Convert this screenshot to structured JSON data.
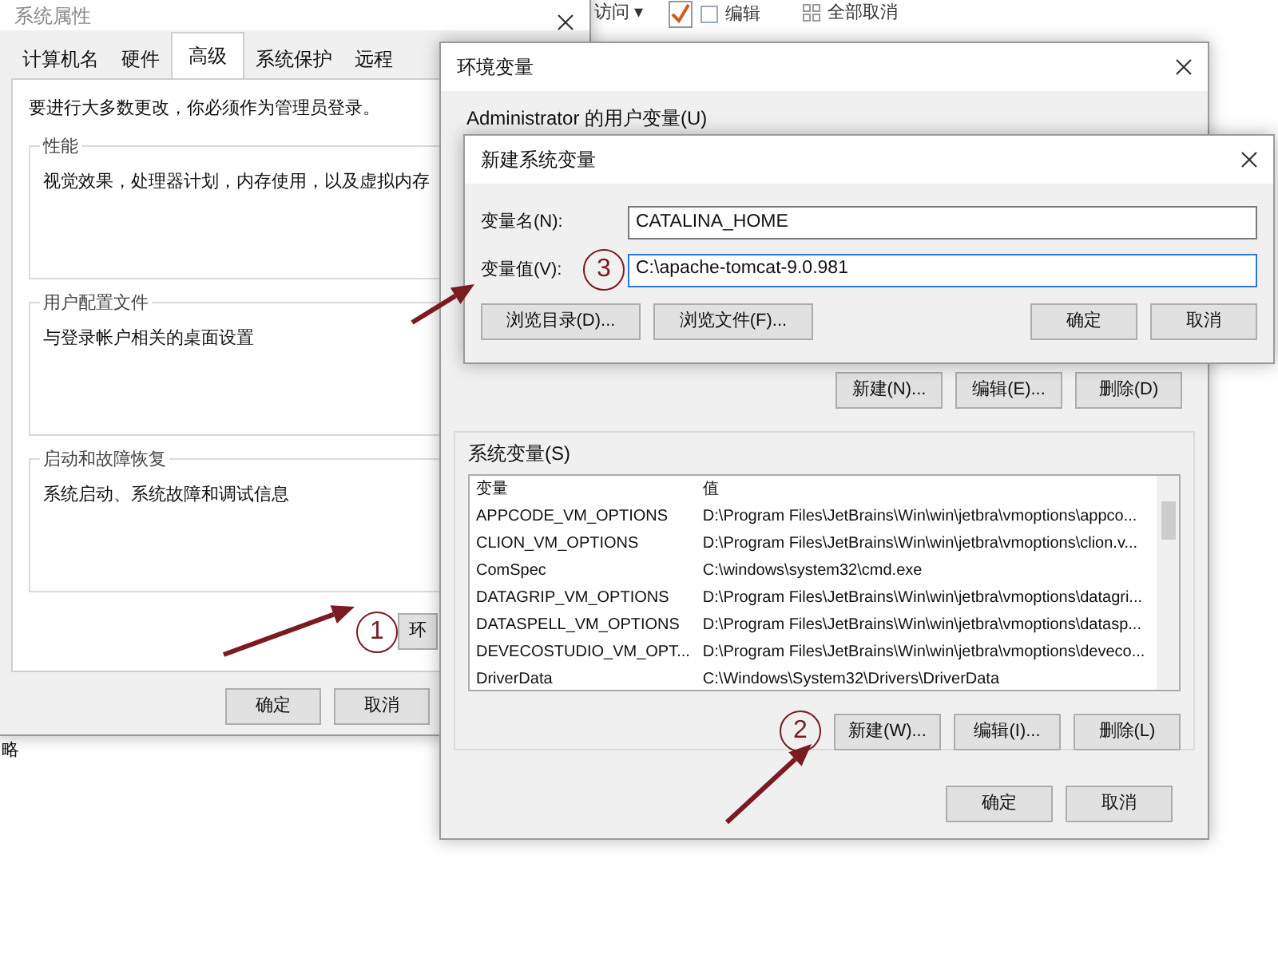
{
  "explorer_ribbon": {
    "items": [
      {
        "kind": "dropdown",
        "label": "访问 ▾"
      },
      {
        "kind": "check",
        "label": "编辑"
      },
      {
        "kind": "grid",
        "label": "全部取消"
      }
    ]
  },
  "side_text": "略",
  "system_properties": {
    "title": "系统属性",
    "tabs": [
      {
        "label": "计算机名",
        "selected": false
      },
      {
        "label": "硬件",
        "selected": false
      },
      {
        "label": "高级",
        "selected": true
      },
      {
        "label": "系统保护",
        "selected": false
      },
      {
        "label": "远程",
        "selected": false
      }
    ],
    "notice": "要进行大多数更改，你必须作为管理员登录。",
    "groups": [
      {
        "title": "性能",
        "text": "视觉效果，处理器计划，内存使用，以及虚拟内存"
      },
      {
        "title": "用户配置文件",
        "text": "与登录帐户相关的桌面设置"
      },
      {
        "title": "启动和故障恢复",
        "text": "系统启动、系统故障和调试信息"
      }
    ],
    "env_button": {
      "label": "环",
      "step": "1"
    },
    "buttons": [
      "确定",
      "取消"
    ]
  },
  "environment_variables": {
    "title": "环境变量",
    "user_vars_label": "Administrator 的用户变量(U)",
    "user_buttons": [
      {
        "label": "新建(N)..."
      },
      {
        "label": "编辑(E)..."
      },
      {
        "label": "删除(D)"
      }
    ],
    "system_vars_label": "系统变量(S)",
    "table": {
      "columns": [
        "变量",
        "值"
      ],
      "rows": [
        [
          "APPCODE_VM_OPTIONS",
          "D:\\Program Files\\JetBrains\\Win\\win\\jetbra\\vmoptions\\appco..."
        ],
        [
          "CLION_VM_OPTIONS",
          "D:\\Program Files\\JetBrains\\Win\\win\\jetbra\\vmoptions\\clion.v..."
        ],
        [
          "ComSpec",
          "C:\\windows\\system32\\cmd.exe"
        ],
        [
          "DATAGRIP_VM_OPTIONS",
          "D:\\Program Files\\JetBrains\\Win\\win\\jetbra\\vmoptions\\datagri..."
        ],
        [
          "DATASPELL_VM_OPTIONS",
          "D:\\Program Files\\JetBrains\\Win\\win\\jetbra\\vmoptions\\datasp..."
        ],
        [
          "DEVECOSTUDIO_VM_OPT...",
          "D:\\Program Files\\JetBrains\\Win\\win\\jetbra\\vmoptions\\deveco..."
        ],
        [
          "DriverData",
          "C:\\Windows\\System32\\Drivers\\DriverData"
        ]
      ]
    },
    "system_buttons": [
      {
        "label": "新建(W)...",
        "step": "2"
      },
      {
        "label": "编辑(I)..."
      },
      {
        "label": "删除(L)"
      }
    ],
    "buttons": [
      "确定",
      "取消"
    ]
  },
  "new_system_variable": {
    "title": "新建系统变量",
    "fields": [
      {
        "label": "变量名(N):",
        "value": "CATALINA_HOME",
        "focused": false
      },
      {
        "label": "变量值(V):",
        "value": "C:\\apache-tomcat-9.0.981",
        "focused": true,
        "step": "3"
      }
    ],
    "buttons_left": [
      "浏览目录(D)...",
      "浏览文件(F)..."
    ],
    "buttons_right": [
      "确定",
      "取消"
    ]
  }
}
